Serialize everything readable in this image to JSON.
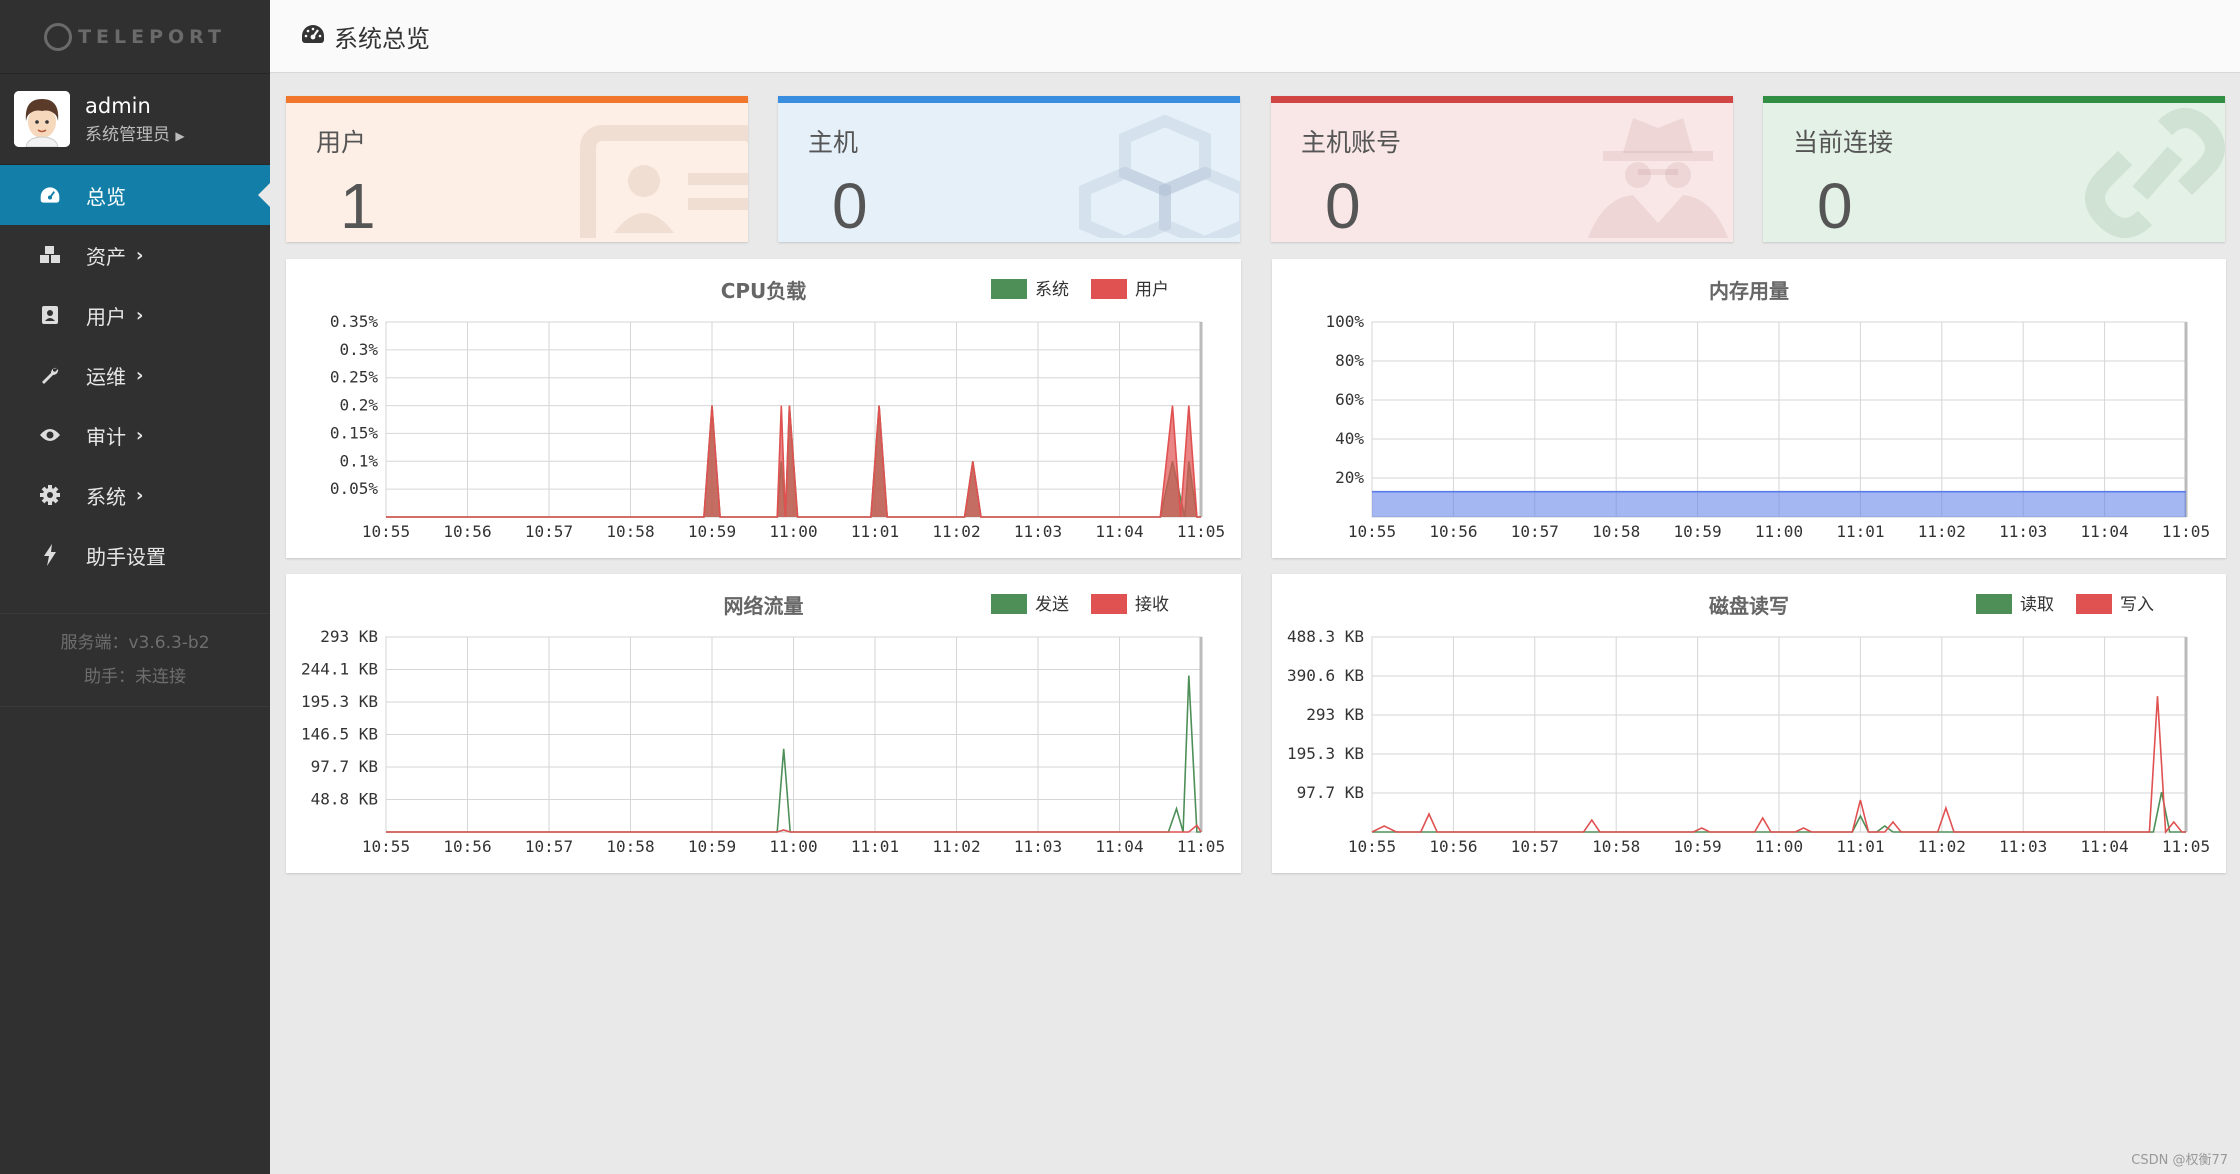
{
  "app": {
    "logo_text": "TELEPORT"
  },
  "user": {
    "name": "admin",
    "role": "系统管理员"
  },
  "sidebar": {
    "items": [
      {
        "label": "总览",
        "icon": "dashboard-icon",
        "active": true,
        "has_submenu": false
      },
      {
        "label": "资产",
        "icon": "cubes-icon",
        "active": false,
        "has_submenu": true
      },
      {
        "label": "用户",
        "icon": "address-book-icon",
        "active": false,
        "has_submenu": true
      },
      {
        "label": "运维",
        "icon": "wrench-icon",
        "active": false,
        "has_submenu": true
      },
      {
        "label": "审计",
        "icon": "eye-icon",
        "active": false,
        "has_submenu": true
      },
      {
        "label": "系统",
        "icon": "gear-icon",
        "active": false,
        "has_submenu": true
      },
      {
        "label": "助手设置",
        "icon": "bolt-icon",
        "active": false,
        "has_submenu": false
      }
    ],
    "server_version": "服务端：v3.6.3-b2",
    "assistant_status": "助手：未连接"
  },
  "header": {
    "title": "系统总览",
    "icon": "dashboard-icon"
  },
  "stats": [
    {
      "label": "用户",
      "value": "1",
      "color": "#f0772c",
      "bg": "#fdefe6",
      "icon": "id-card-icon"
    },
    {
      "label": "主机",
      "value": "0",
      "color": "#3a8ee0",
      "bg": "#e6f0f9",
      "icon": "cubes-icon"
    },
    {
      "label": "主机账号",
      "value": "0",
      "color": "#d24545",
      "bg": "#f9e6e6",
      "icon": "user-secret-icon"
    },
    {
      "label": "当前连接",
      "value": "0",
      "color": "#318e43",
      "bg": "#e4f1e6",
      "icon": "link-icon"
    }
  ],
  "chart_data": [
    {
      "type": "area",
      "title": "CPU负载",
      "categories": [
        "10:55",
        "10:56",
        "10:57",
        "10:58",
        "10:59",
        "11:00",
        "11:01",
        "11:02",
        "11:03",
        "11:04",
        "11:05"
      ],
      "yticks": [
        "0.35%",
        "0.3%",
        "0.25%",
        "0.2%",
        "0.15%",
        "0.1%",
        "0.05%"
      ],
      "ylim": [
        0,
        0.35
      ],
      "legend_position": "top-right",
      "series": [
        {
          "name": "系统",
          "color": "#4e8f58",
          "points": [
            [
              3.9,
              0
            ],
            [
              4,
              0.2
            ],
            [
              4.1,
              0
            ],
            [
              4.8,
              0
            ],
            [
              4.85,
              0.1
            ],
            [
              4.9,
              0
            ],
            [
              4.95,
              0.2
            ],
            [
              5.05,
              0
            ],
            [
              5.95,
              0
            ],
            [
              6.05,
              0.2
            ],
            [
              6.15,
              0
            ],
            [
              7.1,
              0
            ],
            [
              7.2,
              0.1
            ],
            [
              7.3,
              0
            ],
            [
              9.5,
              0
            ],
            [
              9.65,
              0.1
            ],
            [
              9.8,
              0
            ],
            [
              9.85,
              0.1
            ],
            [
              9.95,
              0
            ]
          ]
        },
        {
          "name": "用户",
          "color": "#e05151",
          "points": [
            [
              3.9,
              0
            ],
            [
              4,
              0.2
            ],
            [
              4.1,
              0
            ],
            [
              4.8,
              0
            ],
            [
              4.85,
              0.2
            ],
            [
              4.9,
              0
            ],
            [
              4.95,
              0.2
            ],
            [
              5.05,
              0
            ],
            [
              5.95,
              0
            ],
            [
              6.05,
              0.2
            ],
            [
              6.15,
              0
            ],
            [
              7.1,
              0
            ],
            [
              7.2,
              0.1
            ],
            [
              7.3,
              0
            ],
            [
              9.5,
              0
            ],
            [
              9.65,
              0.2
            ],
            [
              9.75,
              0
            ],
            [
              9.85,
              0.2
            ],
            [
              9.95,
              0
            ]
          ]
        }
      ]
    },
    {
      "type": "area",
      "title": "内存用量",
      "categories": [
        "10:55",
        "10:56",
        "10:57",
        "10:58",
        "10:59",
        "11:00",
        "11:01",
        "11:02",
        "11:03",
        "11:04",
        "11:05"
      ],
      "yticks": [
        "100%",
        "80%",
        "60%",
        "40%",
        "20%"
      ],
      "ylim": [
        0,
        100
      ],
      "series": [
        {
          "name": "",
          "color": "#5b7be8",
          "points": [
            [
              0,
              13
            ],
            [
              10,
              13
            ]
          ]
        }
      ]
    },
    {
      "type": "line",
      "title": "网络流量",
      "categories": [
        "10:55",
        "10:56",
        "10:57",
        "10:58",
        "10:59",
        "11:00",
        "11:01",
        "11:02",
        "11:03",
        "11:04",
        "11:05"
      ],
      "yticks": [
        "293 KB",
        "244.1 KB",
        "195.3 KB",
        "146.5 KB",
        "97.7 KB",
        "48.8 KB"
      ],
      "ylim": [
        0,
        293
      ],
      "legend_position": "top-right",
      "series": [
        {
          "name": "发送",
          "color": "#4e8f58",
          "points": [
            [
              4.8,
              0
            ],
            [
              4.88,
              125
            ],
            [
              4.96,
              0
            ],
            [
              9.6,
              0
            ],
            [
              9.7,
              35
            ],
            [
              9.78,
              0
            ],
            [
              9.85,
              235
            ],
            [
              9.95,
              0
            ]
          ]
        },
        {
          "name": "接收",
          "color": "#e05151",
          "points": [
            [
              4.8,
              0
            ],
            [
              4.88,
              3
            ],
            [
              4.96,
              0
            ],
            [
              9.85,
              0
            ],
            [
              9.95,
              10
            ],
            [
              10,
              0
            ]
          ]
        }
      ]
    },
    {
      "type": "line",
      "title": "磁盘读写",
      "categories": [
        "10:55",
        "10:56",
        "10:57",
        "10:58",
        "10:59",
        "11:00",
        "11:01",
        "11:02",
        "11:03",
        "11:04",
        "11:05"
      ],
      "yticks": [
        "488.3 KB",
        "390.6 KB",
        "293 KB",
        "195.3 KB",
        "97.7 KB"
      ],
      "ylim": [
        0,
        488.3
      ],
      "legend_position": "top-right",
      "series": [
        {
          "name": "读取",
          "color": "#4e8f58",
          "points": [
            [
              5.9,
              0
            ],
            [
              6,
              40
            ],
            [
              6.1,
              0
            ],
            [
              6.2,
              0
            ],
            [
              6.3,
              15
            ],
            [
              6.4,
              0
            ],
            [
              9.6,
              0
            ],
            [
              9.7,
              100
            ],
            [
              9.8,
              0
            ]
          ]
        },
        {
          "name": "写入",
          "color": "#e05151",
          "points": [
            [
              0,
              0
            ],
            [
              0.15,
              15
            ],
            [
              0.3,
              0
            ],
            [
              0.6,
              0
            ],
            [
              0.7,
              45
            ],
            [
              0.8,
              0
            ],
            [
              2.6,
              0
            ],
            [
              2.7,
              30
            ],
            [
              2.8,
              0
            ],
            [
              3.95,
              0
            ],
            [
              4.05,
              10
            ],
            [
              4.15,
              0
            ],
            [
              4.7,
              0
            ],
            [
              4.8,
              35
            ],
            [
              4.9,
              0
            ],
            [
              5.2,
              0
            ],
            [
              5.3,
              10
            ],
            [
              5.4,
              0
            ],
            [
              5.9,
              0
            ],
            [
              6,
              80
            ],
            [
              6.1,
              0
            ],
            [
              6.3,
              0
            ],
            [
              6.4,
              25
            ],
            [
              6.5,
              0
            ],
            [
              6.95,
              0
            ],
            [
              7.05,
              60
            ],
            [
              7.15,
              0
            ],
            [
              9.55,
              0
            ],
            [
              9.65,
              340
            ],
            [
              9.75,
              0
            ],
            [
              9.85,
              25
            ],
            [
              9.95,
              0
            ]
          ]
        }
      ]
    }
  ],
  "footer": {
    "watermark": "CSDN @权衡77"
  }
}
